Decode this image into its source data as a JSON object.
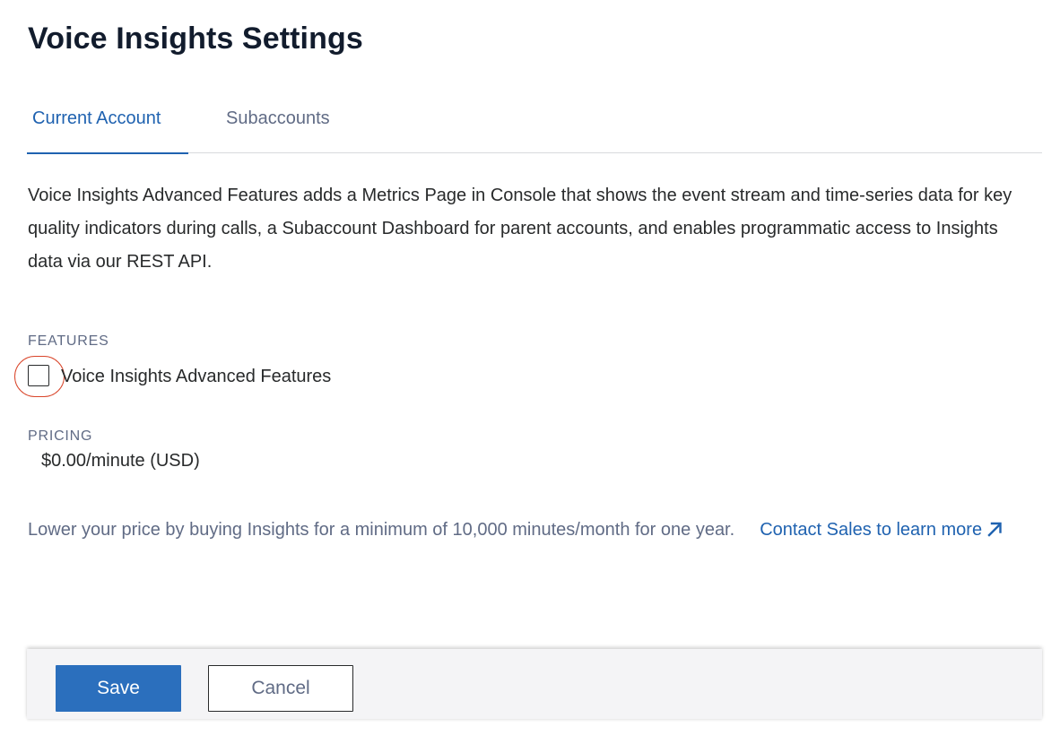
{
  "page_title": "Voice Insights Settings",
  "tabs": [
    {
      "label": "Current Account",
      "active": true
    },
    {
      "label": "Subaccounts",
      "active": false
    }
  ],
  "description": "Voice Insights Advanced Features adds a Metrics Page in Console that shows the event stream and time-series data for key quality indicators during calls, a Subaccount Dashboard for parent accounts, and enables programmatic access to Insights data via our REST API.",
  "features": {
    "label": "FEATURES",
    "checkbox_label": "Voice Insights Advanced Features",
    "checked": false
  },
  "pricing": {
    "label": "PRICING",
    "value": "$0.00/minute (USD)"
  },
  "promo": {
    "text": "Lower your price by buying Insights for a minimum of 10,000 minutes/month for one year.",
    "link_text": "Contact Sales to learn more",
    "link_icon": "external-arrow-icon"
  },
  "footer": {
    "save_label": "Save",
    "cancel_label": "Cancel"
  },
  "colors": {
    "accent": "#1f62b0",
    "save_button": "#2b6fbd",
    "highlight_ring": "#d9452a",
    "muted_text": "#606b85"
  }
}
